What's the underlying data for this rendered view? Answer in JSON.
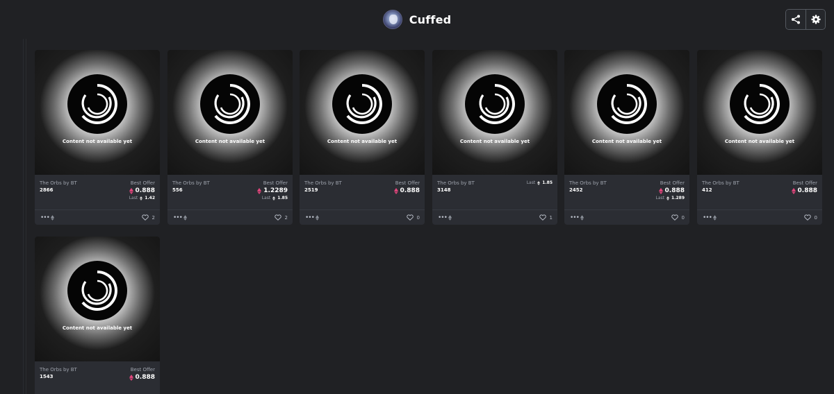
{
  "header": {
    "title": "Cuffed"
  },
  "placeholder_text": "Content not available yet",
  "labels": {
    "best_offer": "Best Offer",
    "last": "Last"
  },
  "colors": {
    "background": "#202124",
    "card": "#2b2d33",
    "eth_accent": "#e0457b"
  },
  "icons": {
    "share": "share-icon",
    "settings": "gear-icon",
    "more": "more-dots-icon",
    "likes": "heart-icon",
    "currency": "eth-icon"
  },
  "cards": [
    {
      "collection": "The Orbs by BT",
      "token": "2866",
      "best_offer": "0.888",
      "last": "1.42",
      "likes": "2"
    },
    {
      "collection": "The Orbs by BT",
      "token": "556",
      "best_offer": "1.2289",
      "last": "1.85",
      "likes": "2"
    },
    {
      "collection": "The Orbs by BT",
      "token": "2519",
      "best_offer": "0.888",
      "last": "",
      "likes": "0"
    },
    {
      "collection": "The Orbs by BT",
      "token": "3148",
      "best_offer": "",
      "last": "1.85",
      "likes": "1"
    },
    {
      "collection": "The Orbs by BT",
      "token": "2452",
      "best_offer": "0.888",
      "last": "1.289",
      "likes": "0"
    },
    {
      "collection": "The Orbs by BT",
      "token": "412",
      "best_offer": "0.888",
      "last": "",
      "likes": "0"
    },
    {
      "collection": "The Orbs by BT",
      "token": "1543",
      "best_offer": "0.888",
      "last": "",
      "likes": ""
    }
  ]
}
